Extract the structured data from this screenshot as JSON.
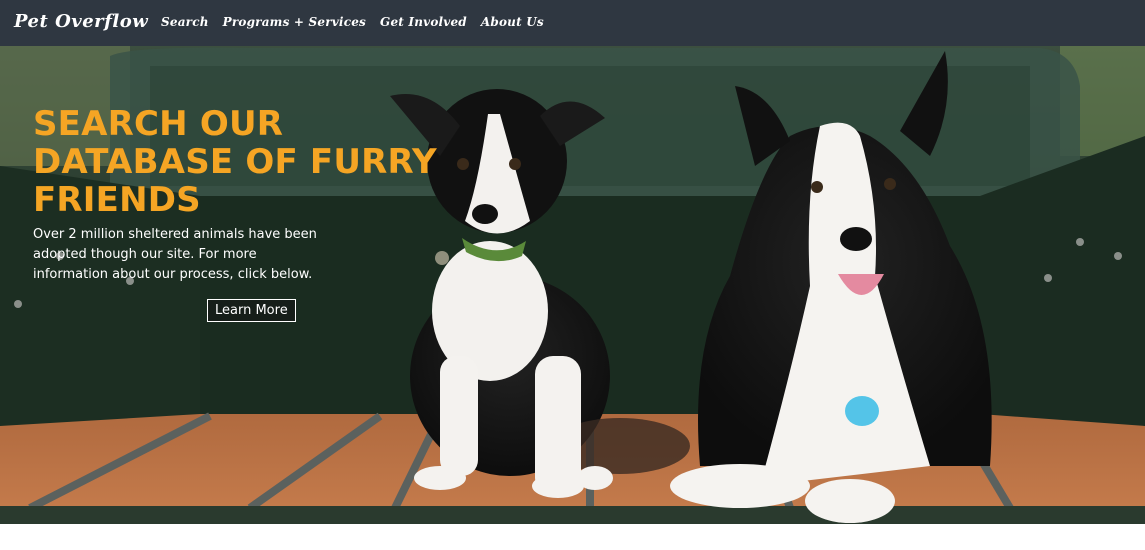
{
  "nav": {
    "brand": "Pet Overflow",
    "links": [
      "Search",
      "Programs + Services",
      "Get Involved",
      "About Us"
    ]
  },
  "hero": {
    "headline": "SEARCH OUR DATABASE OF FURRY FRIENDS",
    "description": "Over 2 million sheltered animals have been adopted though our site. For more information about our process, click below.",
    "button_label": "Learn More"
  },
  "colors": {
    "nav_bg": "#2f3741",
    "headline": "#f5a524"
  },
  "icons": {
    "tag_left": "green-collar-tag",
    "tag_right": "blue-heart-tag"
  }
}
